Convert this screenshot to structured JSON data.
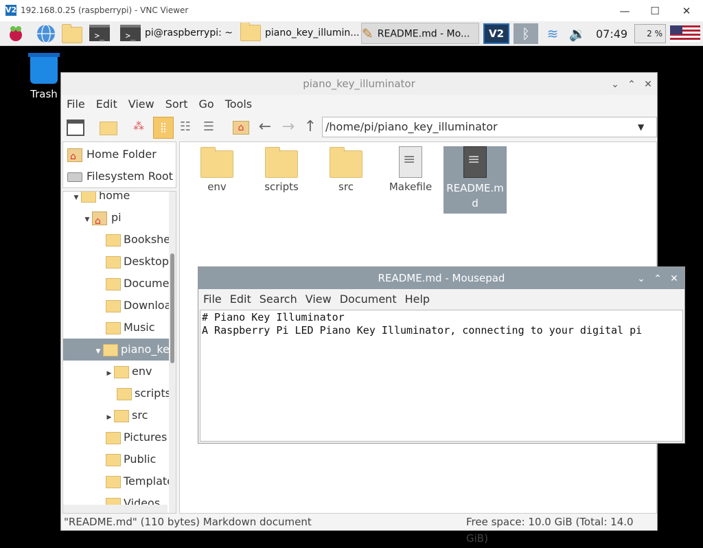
{
  "vnc": {
    "title": "192.168.0.25 (raspberrypi) - VNC Viewer",
    "logo": "V2",
    "minimize": "—",
    "maximize": "☐",
    "close": "✕"
  },
  "taskbar": {
    "tasks": [
      {
        "label": "pi@raspberrypi: ~",
        "icon": "terminal-icon"
      },
      {
        "label": "piano_key_illumin...",
        "icon": "folder-icon"
      },
      {
        "label": "README.md - Mo...",
        "icon": "pencil-icon"
      }
    ],
    "clock": "07:49",
    "cpu": "2 %"
  },
  "desktop": {
    "trash_label": "Trash"
  },
  "file_manager": {
    "title": "piano_key_illuminator",
    "menu": [
      "File",
      "Edit",
      "View",
      "Sort",
      "Go",
      "Tools"
    ],
    "location": "/home/pi/piano_key_illuminator",
    "places": [
      {
        "label": "Home Folder",
        "icon": "home-folder-icon"
      },
      {
        "label": "Filesystem Root",
        "icon": "drive-icon"
      }
    ],
    "tree": [
      {
        "label": "home",
        "indent": 1,
        "expander": "▼"
      },
      {
        "label": "pi",
        "indent": 2,
        "expander": "▼"
      },
      {
        "label": "Bookshe",
        "indent": 3,
        "expander": ""
      },
      {
        "label": "Desktop",
        "indent": 3,
        "expander": ""
      },
      {
        "label": "Documer",
        "indent": 3,
        "expander": ""
      },
      {
        "label": "Downloa",
        "indent": 3,
        "expander": ""
      },
      {
        "label": "Music",
        "indent": 3,
        "expander": ""
      },
      {
        "label": "piano_ke",
        "indent": 3,
        "expander": "▼",
        "selected": true
      },
      {
        "label": "env",
        "indent": 4,
        "expander": "▶"
      },
      {
        "label": "scripts",
        "indent": 4,
        "expander": ""
      },
      {
        "label": "src",
        "indent": 4,
        "expander": "▶"
      },
      {
        "label": "Pictures",
        "indent": 3,
        "expander": ""
      },
      {
        "label": "Public",
        "indent": 3,
        "expander": ""
      },
      {
        "label": "Template",
        "indent": 3,
        "expander": ""
      },
      {
        "label": "Videos",
        "indent": 3,
        "expander": ""
      }
    ],
    "files": [
      {
        "name": "env",
        "type": "folder"
      },
      {
        "name": "scripts",
        "type": "folder"
      },
      {
        "name": "src",
        "type": "folder"
      },
      {
        "name": "Makefile",
        "type": "document"
      },
      {
        "name": "README.m\nd",
        "type": "document",
        "selected": true
      }
    ],
    "status_left": "\"README.md\" (110 bytes) Markdown document",
    "status_right": "Free space: 10.0 GiB (Total: 14.0 GiB)"
  },
  "mousepad": {
    "title": "README.md - Mousepad",
    "menu": [
      "File",
      "Edit",
      "Search",
      "View",
      "Document",
      "Help"
    ],
    "content": "# Piano Key Illuminator\nA Raspberry Pi LED Piano Key Illuminator, connecting to your digital pi"
  },
  "colors": {
    "selection": "#8f9ca6",
    "folder": "#f7d888",
    "trash": "#1e88e5"
  }
}
